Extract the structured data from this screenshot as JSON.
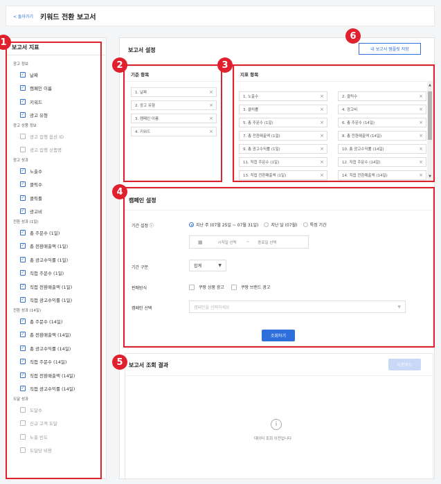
{
  "header": {
    "back_label": "< 돌아가기",
    "title": "키워드 전환 보고서"
  },
  "badges": [
    "1",
    "2",
    "3",
    "4",
    "5",
    "6"
  ],
  "metrics_panel": {
    "title": "보고서 지표",
    "groups": [
      {
        "label": "광고 정보",
        "items": [
          {
            "label": "날짜",
            "checked": true
          },
          {
            "label": "캠페인 이름",
            "checked": true
          },
          {
            "label": "키워드",
            "checked": true
          },
          {
            "label": "광고 유형",
            "checked": true
          }
        ]
      },
      {
        "label": "광고 상품 정보",
        "items": [
          {
            "label": "광고 집행 옵션 ID",
            "checked": false
          },
          {
            "label": "광고 집행 상품명",
            "checked": false
          }
        ]
      },
      {
        "label": "광고 성과",
        "items": [
          {
            "label": "노출수",
            "checked": true
          },
          {
            "label": "클릭수",
            "checked": true
          },
          {
            "label": "클릭률",
            "checked": true
          },
          {
            "label": "광고비",
            "checked": true
          }
        ]
      },
      {
        "label": "전환 성과 (1일)",
        "items": [
          {
            "label": "총 주문수 (1일)",
            "checked": true
          },
          {
            "label": "총 전환매출액 (1일)",
            "checked": true
          },
          {
            "label": "총 광고수익률 (1일)",
            "checked": true
          },
          {
            "label": "직접 주문수 (1일)",
            "checked": true
          },
          {
            "label": "직접 전환매출액 (1일)",
            "checked": true
          },
          {
            "label": "직접 광고수익률 (1일)",
            "checked": true
          }
        ]
      },
      {
        "label": "전환 성과 (14일)",
        "items": [
          {
            "label": "총 주문수 (14일)",
            "checked": true
          },
          {
            "label": "총 전환매출액 (14일)",
            "checked": true
          },
          {
            "label": "총 광고수익률 (14일)",
            "checked": true
          },
          {
            "label": "직접 주문수 (14일)",
            "checked": true
          },
          {
            "label": "직접 전환매출액 (14일)",
            "checked": true
          },
          {
            "label": "직접 광고수익률 (14일)",
            "checked": true
          }
        ]
      },
      {
        "label": "도달 성과",
        "items": [
          {
            "label": "도달수",
            "checked": false
          },
          {
            "label": "신규 고객 도달",
            "checked": false
          },
          {
            "label": "노출 빈도",
            "checked": false
          },
          {
            "label": "도달당 비용",
            "checked": false
          }
        ]
      }
    ]
  },
  "settings": {
    "title": "보고서 설정",
    "save_template_label": "내 보고서 템플릿 저장",
    "basis_panel": {
      "title": "기준 항목",
      "chips": [
        "1. 날짜",
        "2. 광고 유형",
        "3. 캠페인 이름",
        "4. 키워드"
      ]
    },
    "metric_panel": {
      "title": "지표 항목",
      "left": [
        "1. 노출수",
        "3. 클릭률",
        "5. 총 주문수 (1일)",
        "7. 총 전환매출액 (1일)",
        "9. 총 광고수익률 (1일)",
        "11. 직접 주문수 (1일)",
        "13. 직접 전환매출액 (1일)"
      ],
      "right": [
        "2. 클릭수",
        "4. 광고비",
        "6. 총 주문수 (14일)",
        "8. 총 전환매출액 (14일)",
        "10. 총 광고수익률 (14일)",
        "12. 직접 주문수 (14일)",
        "14. 직접 전환매출액 (14일)"
      ]
    }
  },
  "campaign": {
    "title": "캠페인 설정",
    "period_label": "기간 설정 ⓘ",
    "period_options": [
      "지난 주 (07월 25일 ~ 07월 31일)",
      "지난 달 (07월)",
      "특정 기간"
    ],
    "start_placeholder": "시작일 선택",
    "tilde": "~",
    "end_placeholder": "종료일 선택",
    "breakdown_label": "기간 구분",
    "breakdown_value": "합계",
    "sales_label": "판매방식",
    "sales_options": [
      "쿠팡 상품 광고",
      "쿠팡 브랜드 광고"
    ],
    "campaign_label": "캠페인 선택",
    "campaign_placeholder": "캠페인을 선택하세요",
    "query_label": "조회하기"
  },
  "results": {
    "title": "보고서 조회 결과",
    "download_label": "다운로드",
    "empty_text": "데이터 조회 이전입니다"
  }
}
